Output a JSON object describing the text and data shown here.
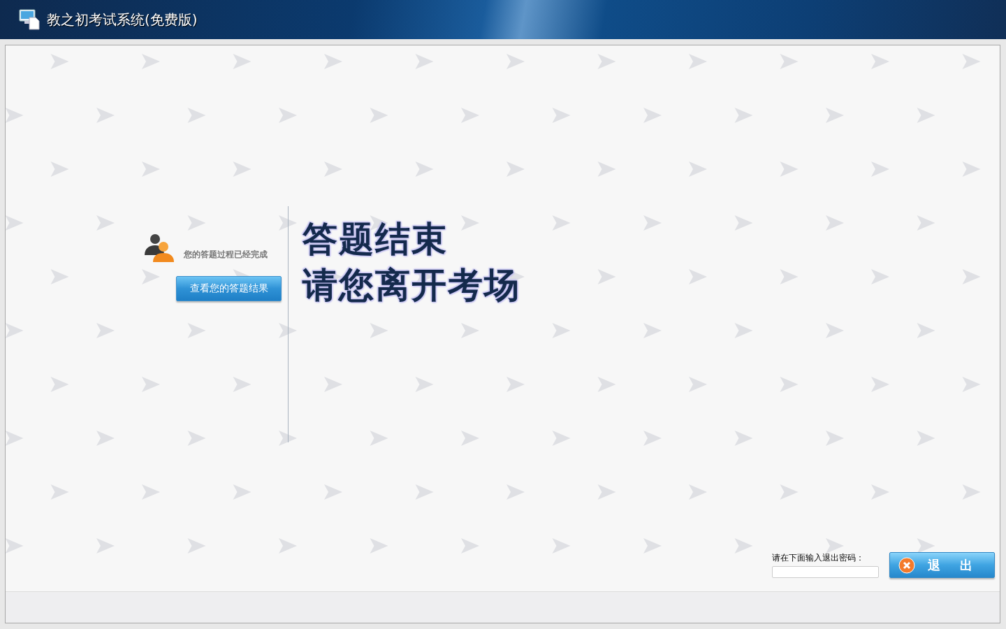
{
  "window": {
    "title": "教之初考试系统(免费版)"
  },
  "status": {
    "message": "您的答题过程已经完成",
    "button": "查看您的答题结果"
  },
  "headline": [
    "答题结束",
    "请您离开考场"
  ],
  "exit": {
    "label": "请在下面输入退出密码：",
    "button": "退 出"
  }
}
